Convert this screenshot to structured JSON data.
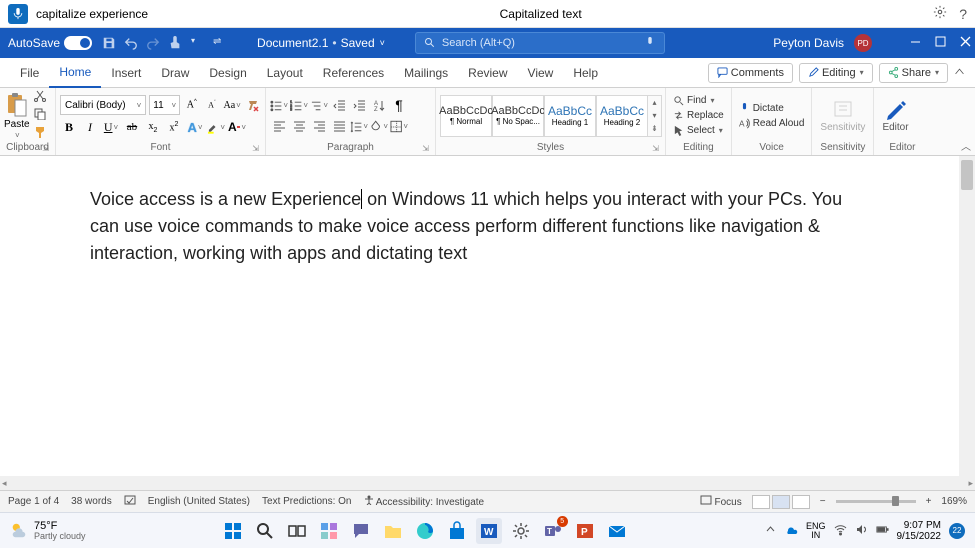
{
  "voice_bar": {
    "command": "capitalize experience",
    "feedback": "Capitalized text"
  },
  "title_bar": {
    "autosave_label": "AutoSave",
    "autosave_on": "On",
    "document_name": "Document2.1",
    "save_state": "Saved",
    "search_placeholder": "Search (Alt+Q)",
    "user_name": "Peyton Davis",
    "user_initials": "PD"
  },
  "tabs": {
    "file": "File",
    "home": "Home",
    "insert": "Insert",
    "draw": "Draw",
    "design": "Design",
    "layout": "Layout",
    "references": "References",
    "mailings": "Mailings",
    "review": "Review",
    "view": "View",
    "help": "Help",
    "comments": "Comments",
    "editing": "Editing",
    "share": "Share"
  },
  "ribbon": {
    "clipboard": {
      "paste": "Paste",
      "label": "Clipboard"
    },
    "font": {
      "name": "Calibri (Body)",
      "size": "11",
      "label": "Font",
      "aa": "Aa"
    },
    "paragraph": {
      "label": "Paragraph"
    },
    "styles": {
      "label": "Styles",
      "preview": "AaBbCcDc",
      "preview_h": "AaBbCc",
      "normal": "¶ Normal",
      "no_spacing": "¶ No Spac...",
      "heading1": "Heading 1",
      "heading2": "Heading 2"
    },
    "editing": {
      "find": "Find",
      "replace": "Replace",
      "select": "Select",
      "label": "Editing"
    },
    "voice": {
      "dictate": "Dictate",
      "read_aloud": "Read Aloud",
      "label": "Voice"
    },
    "sensitivity": {
      "btn": "Sensitivity",
      "label": "Sensitivity"
    },
    "editor": {
      "btn": "Editor",
      "label": "Editor"
    }
  },
  "document": {
    "text": "Voice access is a new Experience on Windows 11 which helps you interact with your PCs. You can use voice commands to make voice access perform different functions like navigation & interaction, working with apps and dictating text",
    "before_cursor": "Voice access is a new Experience",
    "after_cursor": " on Windows 11 which helps you interact with your PCs. You can use voice commands to make voice access perform different functions like navigation & interaction, working with apps and dictating text"
  },
  "status": {
    "page": "Page 1 of 4",
    "words": "38 words",
    "language": "English (United States)",
    "predictions": "Text Predictions: On",
    "accessibility": "Accessibility: Investigate",
    "focus": "Focus",
    "zoom": "169%"
  },
  "taskbar": {
    "temp": "75°F",
    "weather": "Partly cloudy",
    "lang1": "ENG",
    "lang2": "IN",
    "time": "9:07 PM",
    "date": "9/15/2022",
    "notif_count": "22",
    "teams_badge": "5"
  }
}
